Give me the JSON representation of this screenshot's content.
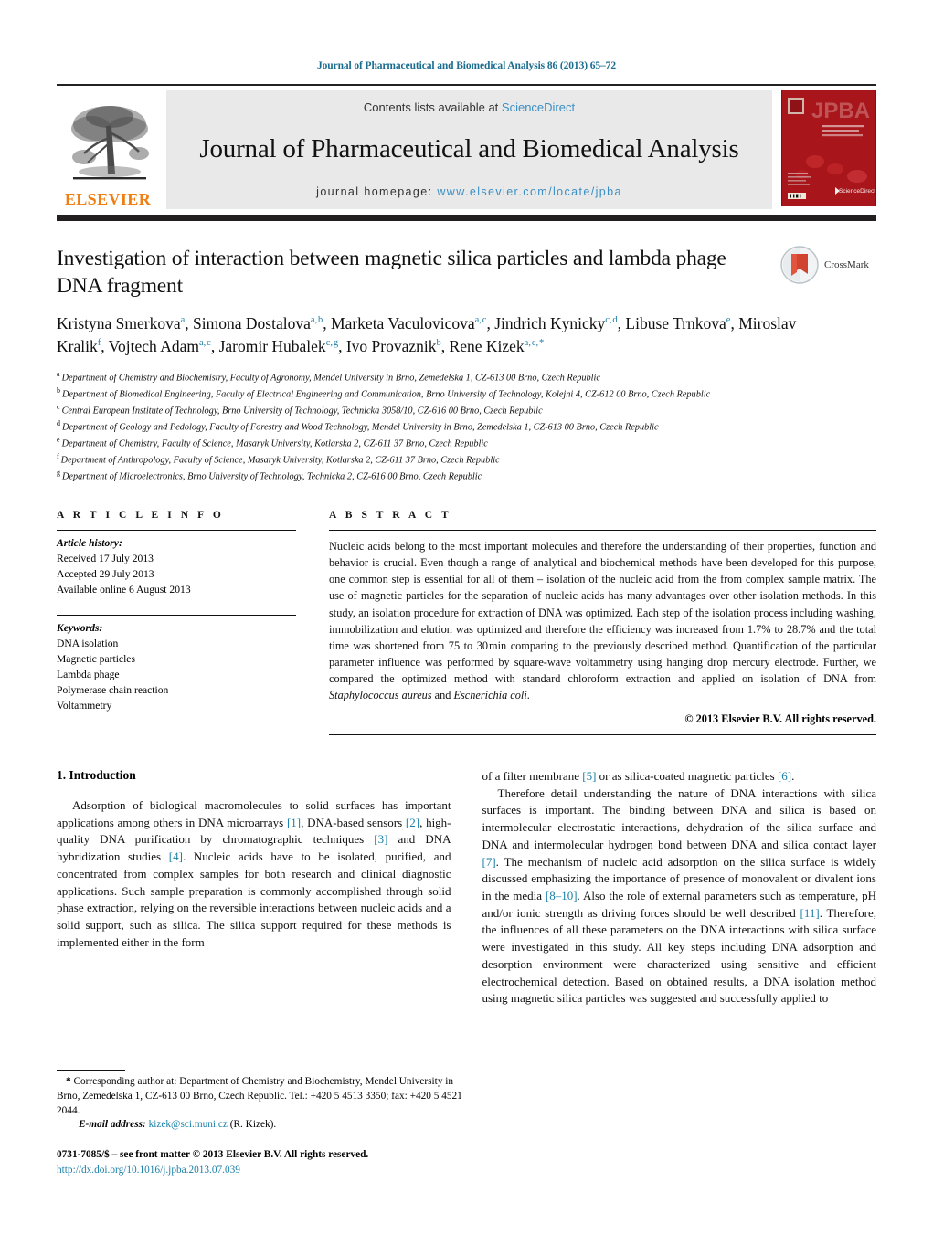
{
  "running_head": "Journal of Pharmaceutical and Biomedical Analysis 86 (2013) 65–72",
  "masthead": {
    "publisher_name": "ELSEVIER",
    "contents_prefix": "Contents lists available at ",
    "contents_link": "ScienceDirect",
    "journal_title": "Journal of Pharmaceutical and Biomedical Analysis",
    "homepage_prefix": "journal homepage: ",
    "homepage_url": "www.elsevier.com/locate/jpba",
    "cover_title": "JPBA",
    "cover_subtitle": "Journal of Pharmaceutical and Biomedical Analysis"
  },
  "article": {
    "title": "Investigation of interaction between magnetic silica particles and lambda phage DNA fragment",
    "crossmark_label": "CrossMark",
    "authors_html": "Kristyna Smerkova<sup>a</sup>, Simona Dostalova<sup>a,&#8202;b</sup>, Marketa Vaculovicova<sup>a,&#8202;c</sup>, Jindrich Kynicky<sup>c,&#8202;d</sup>, Libuse Trnkova<sup>e</sup>, Miroslav Kralik<sup>f</sup>, Vojtech Adam<sup>a,&#8202;c</sup>, Jaromir Hubalek<sup>c,&#8202;g</sup>, Ivo Provaznik<sup>b</sup>, Rene Kizek<sup>a,&#8202;c,&#8202;*</sup>",
    "affiliations": [
      {
        "mark": "a",
        "text": "Department of Chemistry and Biochemistry, Faculty of Agronomy, Mendel University in Brno, Zemedelska 1, CZ-613 00 Brno, Czech Republic"
      },
      {
        "mark": "b",
        "text": "Department of Biomedical Engineering, Faculty of Electrical Engineering and Communication, Brno University of Technology, Kolejni 4, CZ-612 00 Brno, Czech Republic"
      },
      {
        "mark": "c",
        "text": "Central European Institute of Technology, Brno University of Technology, Technicka 3058/10, CZ-616 00 Brno, Czech Republic"
      },
      {
        "mark": "d",
        "text": "Department of Geology and Pedology, Faculty of Forestry and Wood Technology, Mendel University in Brno, Zemedelska 1, CZ-613 00 Brno, Czech Republic"
      },
      {
        "mark": "e",
        "text": "Department of Chemistry, Faculty of Science, Masaryk University, Kotlarska 2, CZ-611 37 Brno, Czech Republic"
      },
      {
        "mark": "f",
        "text": "Department of Anthropology, Faculty of Science, Masaryk University, Kotlarska 2, CZ-611 37 Brno, Czech Republic"
      },
      {
        "mark": "g",
        "text": "Department of Microelectronics, Brno University of Technology, Technicka 2, CZ-616 00 Brno, Czech Republic"
      }
    ]
  },
  "article_info": {
    "heading": "A R T I C L E    I N F O",
    "history_label": "Article history:",
    "history": [
      "Received 17 July 2013",
      "Accepted 29 July 2013",
      "Available online 6 August 2013"
    ],
    "keywords_label": "Keywords:",
    "keywords": [
      "DNA isolation",
      "Magnetic particles",
      "Lambda phage",
      "Polymerase chain reaction",
      "Voltammetry"
    ]
  },
  "abstract": {
    "heading": "A B S T R A C T",
    "body_html": "Nucleic acids belong to the most important molecules and therefore the understanding of their properties, function and behavior is crucial. Even though a range of analytical and biochemical methods have been developed for this purpose, one common step is essential for all of them &#8211; isolation of the nucleic acid from the from complex sample matrix. The use of magnetic particles for the separation of nucleic acids has many advantages over other isolation methods. In this study, an isolation procedure for extraction of DNA was optimized. Each step of the isolation process including washing, immobilization and elution was optimized and therefore the efficiency was increased from 1.7% to 28.7% and the total time was shortened from 75 to 30&#8202;min comparing to the previously described method. Quantification of the particular parameter influence was performed by square-wave voltammetry using hanging drop mercury electrode. Further, we compared the optimized method with standard chloroform extraction and applied on isolation of DNA from <i>Staphylococcus aureus</i> and <i>Escherichia coli</i>.",
    "copyright": "© 2013 Elsevier B.V. All rights reserved."
  },
  "introduction": {
    "section_number_title": "1.  Introduction",
    "left_paragraph_html": "Adsorption of biological macromolecules to solid surfaces has important applications among others in DNA microarrays <span class=\"ref\">[1]</span>, DNA-based sensors <span class=\"ref\">[2]</span>, high-quality DNA purification by chromatographic techniques <span class=\"ref\">[3]</span> and DNA hybridization studies <span class=\"ref\">[4]</span>. Nucleic acids have to be isolated, purified, and concentrated from complex samples for both research and clinical diagnostic applications. Such sample preparation is commonly accomplished through solid phase extraction, relying on the reversible interactions between nucleic acids and a solid support, such as silica. The silica support required for these methods is implemented either in the form",
    "right_paragraph_1_html": "of a filter membrane <span class=\"ref\">[5]</span> or as silica-coated magnetic particles <span class=\"ref\">[6]</span>.",
    "right_paragraph_2_html": "Therefore detail understanding the nature of DNA interactions with silica surfaces is important. The binding between DNA and silica is based on intermolecular electrostatic interactions, dehydration of the silica surface and DNA and intermolecular hydrogen bond between DNA and silica contact layer <span class=\"ref\">[7]</span>. The mechanism of nucleic acid adsorption on the silica surface is widely discussed emphasizing the importance of presence of monovalent or divalent ions in the media <span class=\"ref\">[8&#8211;10]</span>. Also the role of external parameters such as temperature, pH and/or ionic strength as driving forces should be well described <span class=\"ref\">[11]</span>. Therefore, the influences of all these parameters on the DNA interactions with silica surface were investigated in this study. All key steps including DNA adsorption and desorption environment were characterized using sensitive and efficient electrochemical detection. Based on obtained results, a DNA isolation method using magnetic silica particles was suggested and successfully applied to"
  },
  "footnote": {
    "corresponding_html": "<b>*</b> Corresponding author at: Department of Chemistry and Biochemistry, Mendel University in Brno, Zemedelska 1, CZ-613 00 Brno, Czech Republic. Tel.: +420 5 4513 3350; fax: +420 5 4521 2044.",
    "email_label": "E-mail address:",
    "email": "kizek@sci.muni.cz",
    "email_owner": "(R. Kizek).",
    "issn_line": "0731-7085/$ – see front matter © 2013 Elsevier B.V. All rights reserved.",
    "doi": "http://dx.doi.org/10.1016/j.jpba.2013.07.039"
  },
  "colors": {
    "link_blue": "#1a7fa8",
    "science_direct_blue": "#3b8fc4",
    "elsevier_orange": "#f07f13",
    "cover_red": "#a8161b",
    "rule_black": "#231f20"
  }
}
